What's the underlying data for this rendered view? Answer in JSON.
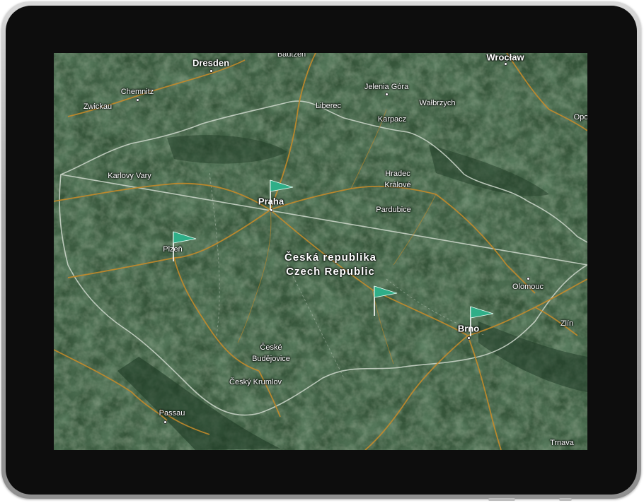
{
  "map": {
    "country_name_cs": "Česká republika",
    "country_name_en": "Czech Republic",
    "colors": {
      "terrain_base": "#2f4e34",
      "forest": "#23402a",
      "field": "#4f6a4c",
      "road": "#c48a2a",
      "border": "#cfd8cc",
      "flag": "#2fae88"
    },
    "cities": {
      "bautzen": "Bautzen",
      "wroclaw": "Wrocław",
      "dresden": "Dresden",
      "chemnitz": "Chemnitz",
      "zwickau": "Zwickau",
      "jelenia_gora": "Jelenia Góra",
      "liberec": "Liberec",
      "walbrzych": "Wałbrzych",
      "karpacz": "Karpacz",
      "opole": "Opo",
      "karlovy_vary": "Karlovy Vary",
      "hradec": "Hradec",
      "kralove": "Králové",
      "praha": "Praha",
      "pardubice": "Pardubice",
      "plzen": "Plzeň",
      "olomouc": "Olomouc",
      "brno": "Brno",
      "zlin": "Zlín",
      "ceske": "České",
      "budejovice": "Budějovice",
      "cesky_krumlov": "Český Krumlov",
      "passau": "Passau",
      "trnava": "Trnava"
    },
    "markers": [
      {
        "name": "flag-marker-praha",
        "icon": "flag-icon"
      },
      {
        "name": "flag-marker-plzen",
        "icon": "flag-icon"
      },
      {
        "name": "flag-marker-vysocina",
        "icon": "flag-icon"
      },
      {
        "name": "flag-marker-brno",
        "icon": "flag-icon"
      }
    ]
  }
}
